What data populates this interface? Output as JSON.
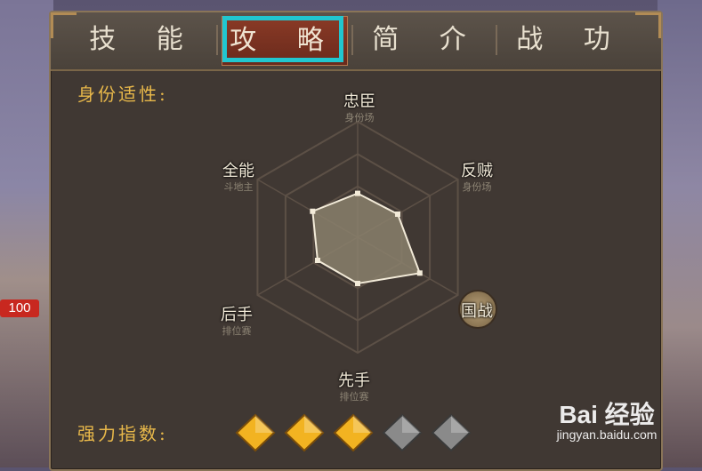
{
  "hp_badge": "100",
  "tabs": [
    {
      "label": "技 能"
    },
    {
      "label": "攻 略"
    },
    {
      "label": "简 介"
    },
    {
      "label": "战 功"
    }
  ],
  "active_tab_index": 1,
  "section_title": "身份适性:",
  "radar": {
    "axes": [
      {
        "main": "忠臣",
        "sub": "身份场"
      },
      {
        "main": "反贼",
        "sub": "身份场"
      },
      {
        "main": "国战",
        "sub": ""
      },
      {
        "main": "先手",
        "sub": "排位赛"
      },
      {
        "main": "后手",
        "sub": "排位赛"
      },
      {
        "main": "全能",
        "sub": "斗地主"
      }
    ],
    "values": [
      0.38,
      0.4,
      0.62,
      0.4,
      0.4,
      0.45
    ]
  },
  "strength": {
    "label": "强力指数:",
    "rating": 3,
    "max": 5,
    "on_color": "#f2b321",
    "off_color": "#8a8a8a"
  },
  "watermark": {
    "top": "Bai 经验",
    "bottom": "jingyan.baidu.com"
  }
}
